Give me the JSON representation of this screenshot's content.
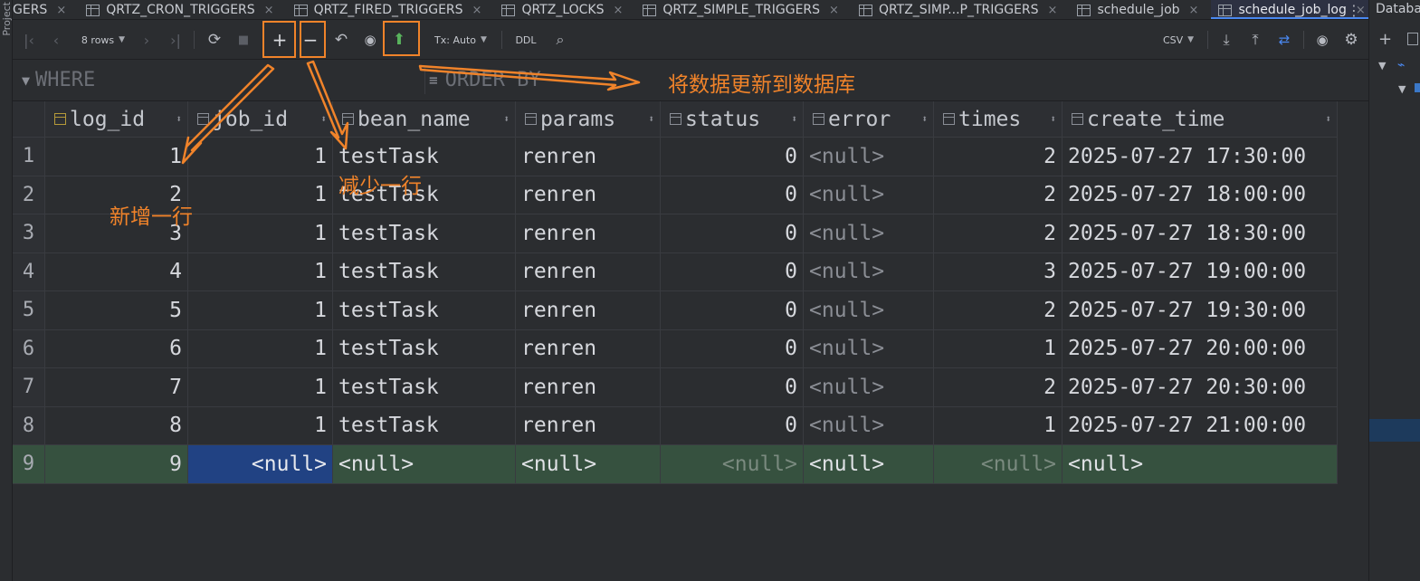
{
  "window": {
    "left_strip_label": "Project",
    "right_panel_title": "Database"
  },
  "tabs": [
    {
      "label": "GERS",
      "active": false
    },
    {
      "label": "QRTZ_CRON_TRIGGERS",
      "active": false
    },
    {
      "label": "QRTZ_FIRED_TRIGGERS",
      "active": false
    },
    {
      "label": "QRTZ_LOCKS",
      "active": false
    },
    {
      "label": "QRTZ_SIMPLE_TRIGGERS",
      "active": false
    },
    {
      "label": "QRTZ_SIMP...P_TRIGGERS",
      "active": false
    },
    {
      "label": "schedule_job",
      "active": false
    },
    {
      "label": "schedule_job_log",
      "active": true
    }
  ],
  "toolbar": {
    "rows_label": "8 rows",
    "tx_label": "Tx: Auto",
    "ddl_label": "DDL",
    "export_format": "CSV"
  },
  "filters": {
    "where_placeholder": "WHERE",
    "orderby_placeholder": "ORDER BY"
  },
  "columns": [
    {
      "name": "log_id",
      "key": true
    },
    {
      "name": "job_id",
      "key": false
    },
    {
      "name": "bean_name",
      "key": false
    },
    {
      "name": "params",
      "key": false
    },
    {
      "name": "status",
      "key": false
    },
    {
      "name": "error",
      "key": false
    },
    {
      "name": "times",
      "key": false
    },
    {
      "name": "create_time",
      "key": false
    }
  ],
  "rows": [
    {
      "rn": "1",
      "log_id": "1",
      "job_id": "1",
      "bean_name": "testTask",
      "params": "renren",
      "status": "0",
      "error": "<null>",
      "times": "2",
      "create_time": "2025-07-27 17:30:00"
    },
    {
      "rn": "2",
      "log_id": "2",
      "job_id": "1",
      "bean_name": "testTask",
      "params": "renren",
      "status": "0",
      "error": "<null>",
      "times": "2",
      "create_time": "2025-07-27 18:00:00"
    },
    {
      "rn": "3",
      "log_id": "3",
      "job_id": "1",
      "bean_name": "testTask",
      "params": "renren",
      "status": "0",
      "error": "<null>",
      "times": "2",
      "create_time": "2025-07-27 18:30:00"
    },
    {
      "rn": "4",
      "log_id": "4",
      "job_id": "1",
      "bean_name": "testTask",
      "params": "renren",
      "status": "0",
      "error": "<null>",
      "times": "3",
      "create_time": "2025-07-27 19:00:00"
    },
    {
      "rn": "5",
      "log_id": "5",
      "job_id": "1",
      "bean_name": "testTask",
      "params": "renren",
      "status": "0",
      "error": "<null>",
      "times": "2",
      "create_time": "2025-07-27 19:30:00"
    },
    {
      "rn": "6",
      "log_id": "6",
      "job_id": "1",
      "bean_name": "testTask",
      "params": "renren",
      "status": "0",
      "error": "<null>",
      "times": "1",
      "create_time": "2025-07-27 20:00:00"
    },
    {
      "rn": "7",
      "log_id": "7",
      "job_id": "1",
      "bean_name": "testTask",
      "params": "renren",
      "status": "0",
      "error": "<null>",
      "times": "2",
      "create_time": "2025-07-27 20:30:00"
    },
    {
      "rn": "8",
      "log_id": "8",
      "job_id": "1",
      "bean_name": "testTask",
      "params": "renren",
      "status": "0",
      "error": "<null>",
      "times": "1",
      "create_time": "2025-07-27 21:00:00"
    }
  ],
  "new_row": {
    "rn": "9",
    "log_id": "9",
    "job_id": "<null>",
    "bean_name": "<null>",
    "params": "<null>",
    "status": "<null>",
    "error": "<null>",
    "times": "<null>",
    "create_time": "<null>"
  },
  "annotations": {
    "add_row": "新增一行",
    "delete_row": "减少一行",
    "submit": "将数据更新到数据库"
  },
  "colors": {
    "annotation": "#f0832a",
    "new_row_bg": "#36513f",
    "selection_bg": "#214283",
    "accent": "#4a88f0"
  },
  "icons": {
    "first_page": "first-page-icon",
    "prev_page": "prev-page-icon",
    "next_page": "next-page-icon",
    "last_page": "last-page-icon",
    "refresh": "refresh-icon",
    "stop": "stop-icon",
    "add_row": "plus-icon",
    "delete_row": "minus-icon",
    "revert": "undo-icon",
    "preview": "eye-icon",
    "submit": "green-up-arrow-icon",
    "search": "search-icon",
    "export": "download-icon",
    "import": "upload-icon",
    "compare": "compare-icon",
    "view": "eye-icon",
    "settings": "gear-icon"
  }
}
